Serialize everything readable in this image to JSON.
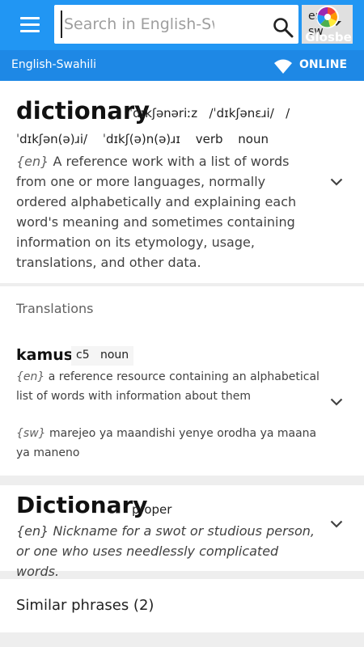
{
  "topbar": {
    "search_placeholder": "Search in English-Swahili",
    "lang_from": "en",
    "lang_to": "sw",
    "logo_text": "Glosbe",
    "bg_color": "#2196f3"
  },
  "subbar": {
    "pair": "English-Swahili",
    "status": "ONLINE"
  },
  "entry": {
    "headword": "dictionary",
    "pron_1": "ˈdɪkʃənəriːz",
    "pron_2": "/ˈdɪkʃənɛɹi/",
    "pron_3": "/",
    "pron_4": "ˈdɪkʃən(ə)ɹi/",
    "pron_5": "ˈdɪkʃ(ə)n(ə)ɹɪ",
    "pos_1": "verb",
    "pos_2": "noun",
    "def_lang": "{en}",
    "definition": "A reference work with a list of words from one or more languages, normally ordered alphabetically and explaining each word's meaning and sometimes containing information on its etymology, usage, translations, and other data."
  },
  "translations": {
    "title": "Translations",
    "items": [
      {
        "word": "kamusi",
        "class": "c5",
        "pos": "noun",
        "def_en_lang": "{en}",
        "def_en": "a reference resource containing an alphabetical list of words with information about them",
        "def_sw_lang": "{sw}",
        "def_sw": "marejeo ya maandishi yenye orodha ya maana ya maneno"
      }
    ]
  },
  "proper": {
    "word": "Dictionary",
    "pos": "proper",
    "def_lang": "{en}",
    "definition": "Nickname for a swot or studious person, or one who uses needlessly complicated words."
  },
  "similar": {
    "label": "Similar phrases (2)"
  }
}
